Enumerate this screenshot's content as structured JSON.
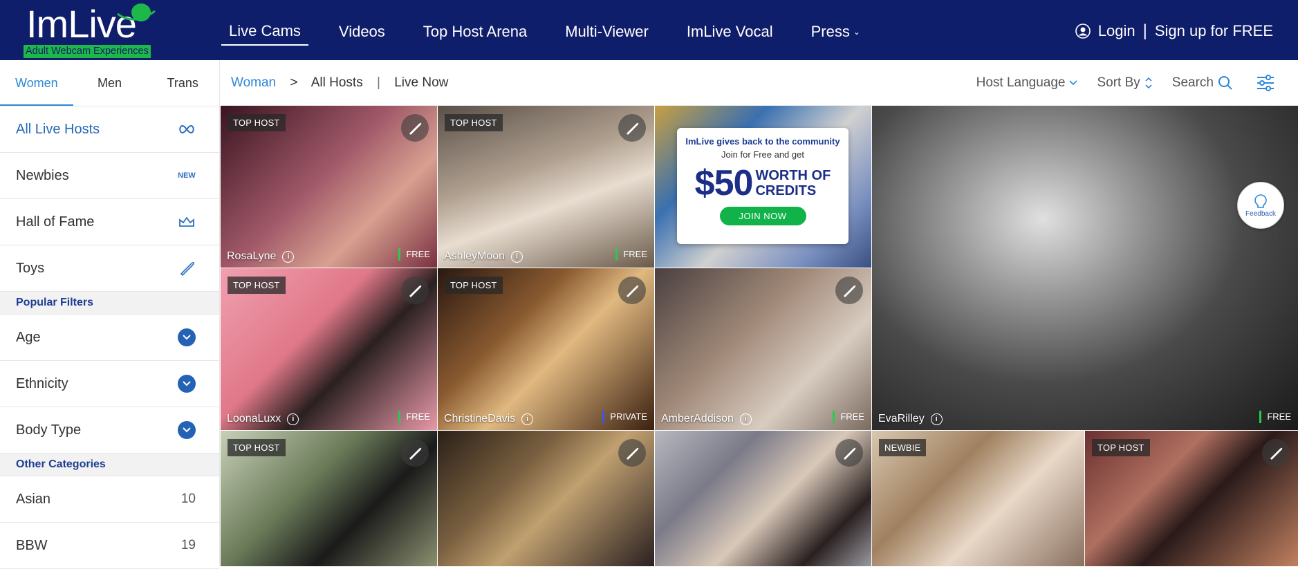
{
  "header": {
    "logo_text": "ImLive",
    "logo_tagline": "Adult Webcam Experiences",
    "nav": [
      {
        "label": "Live Cams",
        "active": true
      },
      {
        "label": "Videos"
      },
      {
        "label": "Top Host Arena"
      },
      {
        "label": "Multi-Viewer"
      },
      {
        "label": "ImLive Vocal"
      },
      {
        "label": "Press",
        "has_dropdown": true
      }
    ],
    "login": "Login",
    "separator": "|",
    "signup": "Sign up for FREE"
  },
  "sidebar": {
    "gender_tabs": [
      {
        "label": "Women",
        "active": true
      },
      {
        "label": "Men"
      },
      {
        "label": "Trans"
      }
    ],
    "items": [
      {
        "label": "All Live Hosts",
        "icon": "infinity-icon",
        "active": true
      },
      {
        "label": "Newbies",
        "icon": "new-icon",
        "icon_text": "NEW"
      },
      {
        "label": "Hall of Fame",
        "icon": "crown-icon"
      },
      {
        "label": "Toys",
        "icon": "toy-icon"
      }
    ],
    "popular_filters_heading": "Popular Filters",
    "filters": [
      {
        "label": "Age"
      },
      {
        "label": "Ethnicity"
      },
      {
        "label": "Body Type"
      }
    ],
    "other_categories_heading": "Other Categories",
    "categories": [
      {
        "label": "Asian",
        "count": "10"
      },
      {
        "label": "BBW",
        "count": "19"
      }
    ]
  },
  "subbar": {
    "crumb_1": "Woman",
    "crumb_sep": ">",
    "crumb_2": "All Hosts",
    "crumb_pipe": "|",
    "crumb_3": "Live Now",
    "host_language": "Host Language",
    "sort_by": "Sort By",
    "search": "Search"
  },
  "tiles": [
    {
      "name": "RosaLyne",
      "badge": "TOP HOST",
      "status": "FREE",
      "color": "#6b2a3a"
    },
    {
      "name": "AshleyMoon",
      "badge": "TOP HOST",
      "status": "FREE",
      "color": "#8a7a6a"
    },
    {
      "name": "LoonaLuxx",
      "badge": "TOP HOST",
      "status": "FREE",
      "color": "#e78a9a"
    },
    {
      "name": "ChristineDavis",
      "badge": "TOP HOST",
      "status": "PRIVATE",
      "color": "#5a3520"
    },
    {
      "name": "AmberAddison",
      "badge": "",
      "status": "FREE",
      "color": "#6d6560"
    },
    {
      "name": "EvaRilley",
      "badge": "",
      "status": "FREE",
      "color": "#3a3a3a"
    },
    {
      "name": "",
      "badge": "TOP HOST",
      "status": "",
      "color": "#7a8a6a"
    },
    {
      "name": "",
      "badge": "",
      "status": "",
      "color": "#4a3a30"
    },
    {
      "name": "",
      "badge": "",
      "status": "",
      "color": "#9a9aa8"
    },
    {
      "name": "",
      "badge": "NEWBIE",
      "status": "",
      "color": "#b8a890"
    },
    {
      "name": "",
      "badge": "TOP HOST",
      "status": "",
      "color": "#8a4a40"
    }
  ],
  "ad": {
    "line1": "ImLive gives back to the community",
    "line2": "Join for Free and get",
    "amount": "$50",
    "words1": "WORTH OF",
    "words2": "CREDITS",
    "button": "JOIN NOW"
  },
  "feedback": "Feedback"
}
